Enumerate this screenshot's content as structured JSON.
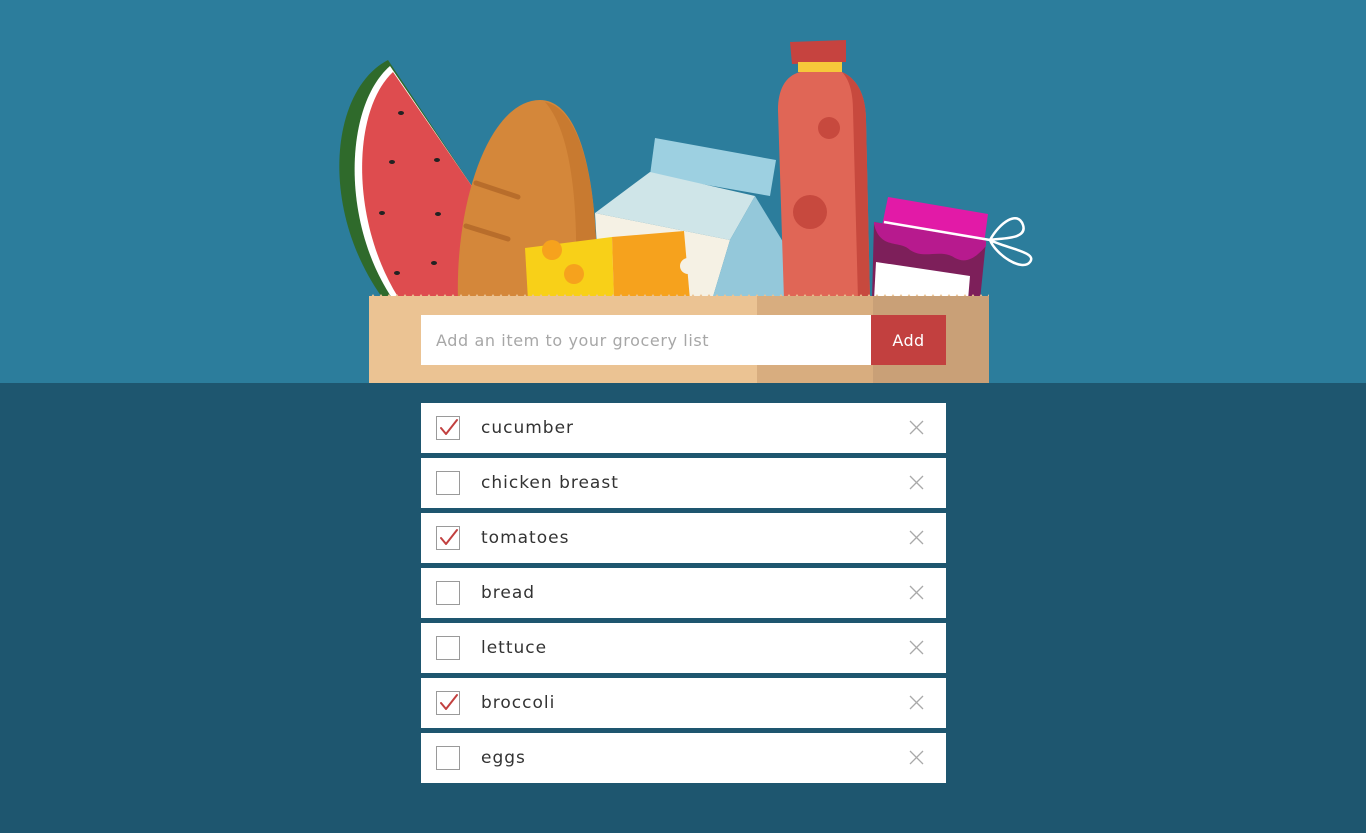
{
  "form": {
    "placeholder": "Add an item to your grocery list",
    "add_label": "Add"
  },
  "icons": {
    "header_illustration": "grocery-bag-illustration",
    "check": "checkmark-icon",
    "delete": "close-icon"
  },
  "colors": {
    "header_bg": "#2c7d9c",
    "page_bg": "#1e566f",
    "accent": "#c2403f",
    "bag": "#ebc393"
  },
  "items": [
    {
      "label": "cucumber",
      "checked": true
    },
    {
      "label": "chicken breast",
      "checked": false
    },
    {
      "label": "tomatoes",
      "checked": true
    },
    {
      "label": "bread",
      "checked": false
    },
    {
      "label": "lettuce",
      "checked": false
    },
    {
      "label": "broccoli",
      "checked": true
    },
    {
      "label": "eggs",
      "checked": false
    }
  ]
}
